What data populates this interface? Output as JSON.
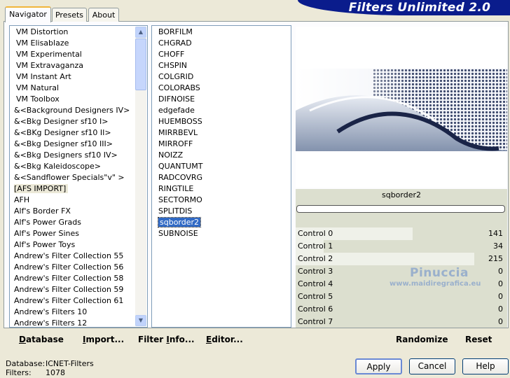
{
  "app_title": "Filters Unlimited 2.0",
  "tabs": [
    {
      "label": "Navigator",
      "active": true
    },
    {
      "label": "Presets",
      "active": false
    },
    {
      "label": "About",
      "active": false
    }
  ],
  "categories": [
    "VM Distortion",
    "VM Elisablaze",
    "VM Experimental",
    "VM Extravaganza",
    "VM Instant Art",
    "VM Natural",
    "VM Toolbox",
    "&<Background Designers IV>",
    "&<Bkg Designer sf10 I>",
    "&<BKg Designer sf10 II>",
    "&<Bkg Designer sf10 III>",
    "&<Bkg Designers sf10 IV>",
    "&<Bkg Kaleidoscope>",
    "&<Sandflower Specials\"v\" >",
    "[AFS IMPORT]",
    "AFH",
    "Alf's Border FX",
    "Alf's Power Grads",
    "Alf's Power Sines",
    "Alf's Power Toys",
    "Andrew's Filter Collection 55",
    "Andrew's Filter Collection 56",
    "Andrew's Filter Collection 58",
    "Andrew's Filter Collection 59",
    "Andrew's Filter Collection 61",
    "Andrew's Filters 10",
    "Andrew's Filters 12"
  ],
  "selected_category": "[AFS IMPORT]",
  "filters": [
    "BORFILM",
    "CHGRAD",
    "CHOFF",
    "CHSPIN",
    "COLGRID",
    "COLORABS",
    "DIFNOISE",
    "edgefade",
    "HUEMBOSS",
    "MIRRBEVL",
    "MIRROFF",
    "NOIZZ",
    "QUANTUMT",
    "RADCOVRG",
    "RINGTILE",
    "SECTORMO",
    "SPLITDIS",
    "sqborder2",
    "SUBNOISE"
  ],
  "selected_filter": "sqborder2",
  "filter_name": "sqborder2",
  "controls": [
    {
      "label": "Control 0",
      "value": 141
    },
    {
      "label": "Control 1",
      "value": 34
    },
    {
      "label": "Control 2",
      "value": 215
    },
    {
      "label": "Control 3",
      "value": 0
    },
    {
      "label": "Control 4",
      "value": 0
    },
    {
      "label": "Control 5",
      "value": 0
    },
    {
      "label": "Control 6",
      "value": 0
    },
    {
      "label": "Control 7",
      "value": 0
    }
  ],
  "watermark": {
    "name": "Pinuccia",
    "site": "www.maidiregrafica.eu"
  },
  "toolbar": {
    "database": "Database",
    "import": "Import...",
    "filter_info": "Filter Info...",
    "editor": "Editor...",
    "randomize": "Randomize",
    "reset": "Reset"
  },
  "status": {
    "database_label": "Database:",
    "database_value": "ICNET-Filters",
    "filters_label": "Filters:",
    "filters_value": "1078"
  },
  "buttons": {
    "apply": "Apply",
    "cancel": "Cancel",
    "help": "Help"
  },
  "colors": {
    "banner": "#0a1c8c",
    "selection": "#316ac5",
    "tab_accent": "#f1b53a"
  }
}
